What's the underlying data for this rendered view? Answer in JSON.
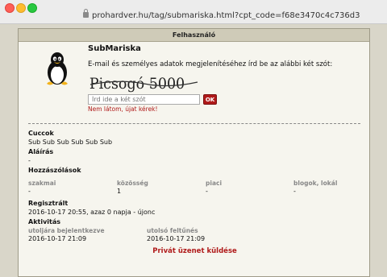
{
  "browser": {
    "url": "prohardver.hu/tag/submariska.html?cpt_code=f68e3470c4c736d3"
  },
  "panel": {
    "title": "Felhasználó"
  },
  "profile": {
    "username": "SubMariska",
    "prompt": "E-mail és személyes adatok megjelenítéséhez írd be az alábbi két szót:",
    "captcha_text": "Picsogó 5000",
    "input_placeholder": "Írd ide a két szót",
    "ok_label": "OK",
    "reload_link": "Nem látom, újat kérek!"
  },
  "sections": {
    "cuccok": {
      "title": "Cuccok",
      "value": "Sub Sub Sub Sub Sub Sub"
    },
    "alairas": {
      "title": "Aláírás",
      "value": "-"
    },
    "hozzaszolasok": {
      "title": "Hozzászólások",
      "columns": [
        {
          "label": "szakmai",
          "value": "-"
        },
        {
          "label": "közösség",
          "value": "1"
        },
        {
          "label": "piaci",
          "value": "-"
        },
        {
          "label": "blogok, lokál",
          "value": "-"
        }
      ]
    },
    "regisztralt": {
      "title": "Regisztrált",
      "value": "2016-10-17 20:55, azaz 0 napja - újonc"
    },
    "aktivitas": {
      "title": "Aktivitás",
      "columns": [
        {
          "label": "utoljára bejelentkezve",
          "value": "2016-10-17 21:09"
        },
        {
          "label": "utolsó feltűnés",
          "value": "2016-10-17 21:09"
        }
      ]
    }
  },
  "actions": {
    "private_message": "Privát üzenet küldése"
  },
  "colors": {
    "accent": "#b01a1a",
    "panel_header": "#cfcbb8",
    "background": "#d9d6c9"
  }
}
